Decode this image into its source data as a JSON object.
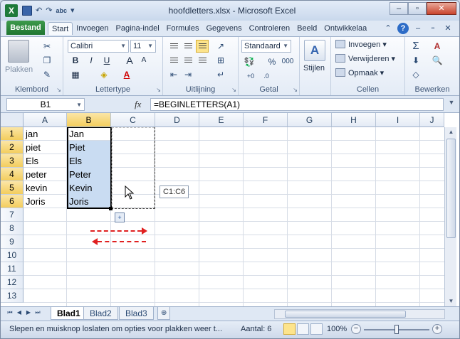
{
  "window": {
    "title": "hoofdletters.xlsx - Microsoft Excel",
    "app_icon": "X",
    "minimize": "–",
    "maximize": "▫",
    "close": "✕"
  },
  "qat": {
    "undo": "↶",
    "redo": "↷",
    "spell": "abc",
    "more": "▾"
  },
  "tabs": {
    "file": "Bestand",
    "items": [
      "Start",
      "Invoegen",
      "Pagina-indel",
      "Formules",
      "Gegevens",
      "Controleren",
      "Beeld",
      "Ontwikkelaa"
    ],
    "active_index": 0
  },
  "ribbon": {
    "clipboard": {
      "paste": "Plakken",
      "label": "Klembord"
    },
    "font": {
      "name": "Calibri",
      "size": "11",
      "bold": "B",
      "italic": "I",
      "underline": "U",
      "grow": "A",
      "shrink": "A",
      "color_letter": "A",
      "label": "Lettertype"
    },
    "alignment": {
      "label": "Uitlijning"
    },
    "number": {
      "format": "Standaard",
      "percent": "%",
      "thousands": "000",
      "label": "Getal"
    },
    "styles": {
      "label": "Stijlen"
    },
    "cells": {
      "insert": "Invoegen",
      "delete": "Verwijderen",
      "format": "Opmaak",
      "label": "Cellen"
    },
    "editing": {
      "sum": "Σ",
      "sort": "A",
      "label": "Bewerken"
    }
  },
  "formula_bar": {
    "name_box": "B1",
    "fx": "fx",
    "formula": "=BEGINLETTERS(A1)"
  },
  "grid": {
    "columns": [
      "A",
      "B",
      "C",
      "D",
      "E",
      "F",
      "G",
      "H",
      "I",
      "J"
    ],
    "rows": [
      "1",
      "2",
      "3",
      "4",
      "5",
      "6",
      "7",
      "8",
      "9",
      "10",
      "11",
      "12",
      "13"
    ],
    "col_a": [
      "jan",
      "piet",
      "Els",
      "peter",
      "kevin",
      "Joris"
    ],
    "col_b": [
      "Jan",
      "Piet",
      "Els",
      "Peter",
      "Kevin",
      "Joris"
    ],
    "selected_column": "B",
    "tooltip": "C1:C6"
  },
  "sheets": {
    "tabs": [
      "Blad1",
      "Blad2",
      "Blad3"
    ],
    "active_index": 0
  },
  "status": {
    "message": "Slepen en muisknop loslaten om opties voor plakken weer t...",
    "count": "Aantal: 6",
    "zoom": "100%",
    "zoom_fraction": 1.0
  },
  "colors": {
    "accent": "#1f7631",
    "selection": "#c9dcf2",
    "header_highlight": "#f3cd5d",
    "arrow": "#e02020"
  }
}
